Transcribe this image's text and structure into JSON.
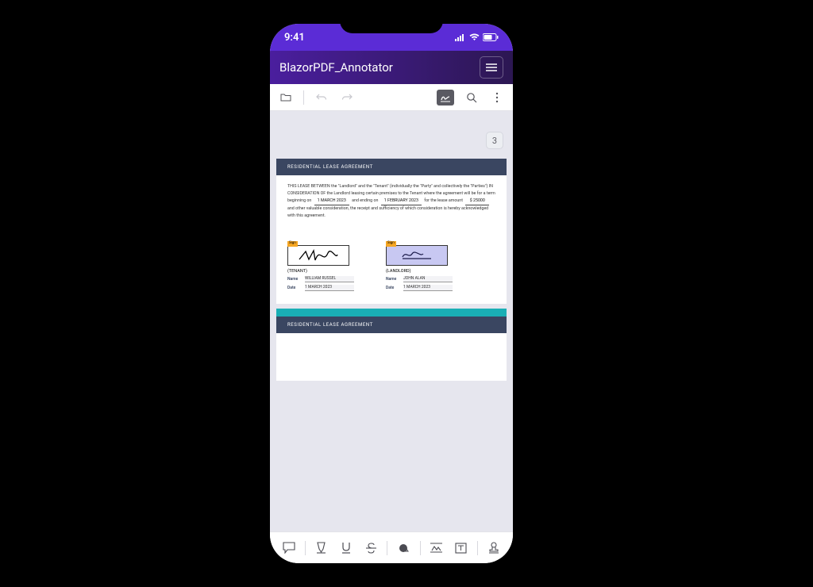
{
  "statusbar": {
    "time": "9:41"
  },
  "header": {
    "title": "BlazorPDF_Annotator"
  },
  "viewer": {
    "page_indicator": "3"
  },
  "document": {
    "section_title": "RESIDENTIAL LEASE AGREEMENT",
    "preamble_a": "THIS LEASE BETWEEN the \"Landlord\" and the \"Tenant\" (individually the \"Party\" and collectively the \"Parties\") IN CONSIDERATION OF the Landlord leasing certain premises to the Tenant where the agreement will be for a term beginning on",
    "term_start": "1 MARCH 2023",
    "preamble_b": "and ending on",
    "term_end": "1 FEBRUARY 2023",
    "preamble_c": "for the lease amount",
    "amount": "$ 25000",
    "preamble_d": "and other valuable consideration, the receipt and sufficiency of which consideration is hereby acknowledged with this agreement.",
    "sign_tag": "Sign",
    "tenant": {
      "role": "(TENANT)",
      "name_label": "Name",
      "name": "WILLIAM RUSSEL",
      "date_label": "Date",
      "date": "1 MARCH 2023"
    },
    "landlord": {
      "role": "(LANDLORD)",
      "name_label": "Name",
      "name": "JOHN ALAN",
      "date_label": "Date",
      "date": "1 MARCH 2023"
    },
    "section_title_2": "RESIDENTIAL LEASE AGREEMENT"
  }
}
